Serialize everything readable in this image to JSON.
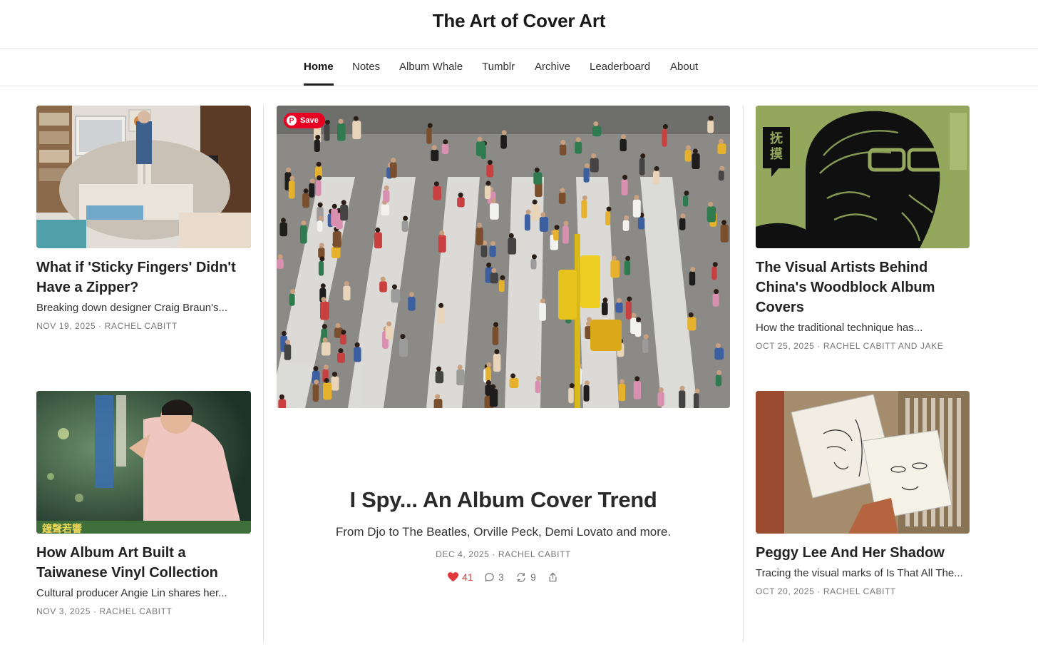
{
  "site": {
    "title": "The Art of Cover Art"
  },
  "nav": {
    "items": [
      {
        "label": "Home",
        "active": true
      },
      {
        "label": "Notes"
      },
      {
        "label": "Album Whale"
      },
      {
        "label": "Tumblr"
      },
      {
        "label": "Archive"
      },
      {
        "label": "Leaderboard"
      },
      {
        "label": "About"
      }
    ]
  },
  "posts": {
    "left": [
      {
        "title": "What if 'Sticky Fingers' Didn't Have a Zipper?",
        "subtitle": "Breaking down designer Craig Braun's...",
        "meta": "NOV 19, 2025 · RACHEL CABITT",
        "thumb": "photo-thumbnail"
      },
      {
        "title": "How Album Art Built a Taiwanese Vinyl Collection",
        "subtitle": "Cultural producer Angie Lin shares her...",
        "meta": "NOV 3, 2025 · RACHEL CABITT",
        "thumb": "album-cover-thumbnail",
        "cover_text": "鐘聲若響"
      }
    ],
    "featured": {
      "title": "I Spy... An Album Cover Trend",
      "subtitle": "From Djo to The Beatles, Orville Peck, Demi Lovato and more.",
      "meta": "DEC 4, 2025 · RACHEL CABITT",
      "save_label": "Save",
      "likes": "41",
      "comments": "3",
      "restacks": "9",
      "like_color": "#e0383e"
    },
    "right": [
      {
        "title": "The Visual Artists Behind China's Woodblock Album Covers",
        "subtitle": "How the traditional technique has...",
        "meta": "OCT 25, 2025 · RACHEL CABITT AND JAKE",
        "thumb": "woodblock-thumbnail",
        "cover_text": "抚摸"
      },
      {
        "title": "Peggy Lee And Her Shadow",
        "subtitle": "Tracing the visual marks of Is That All The...",
        "meta": "OCT 20, 2025 · RACHEL CABITT",
        "thumb": "record-bin-thumbnail"
      }
    ]
  },
  "colors": {
    "pinterest_red": "#e60023",
    "woodblock_green": "#93a85c"
  }
}
